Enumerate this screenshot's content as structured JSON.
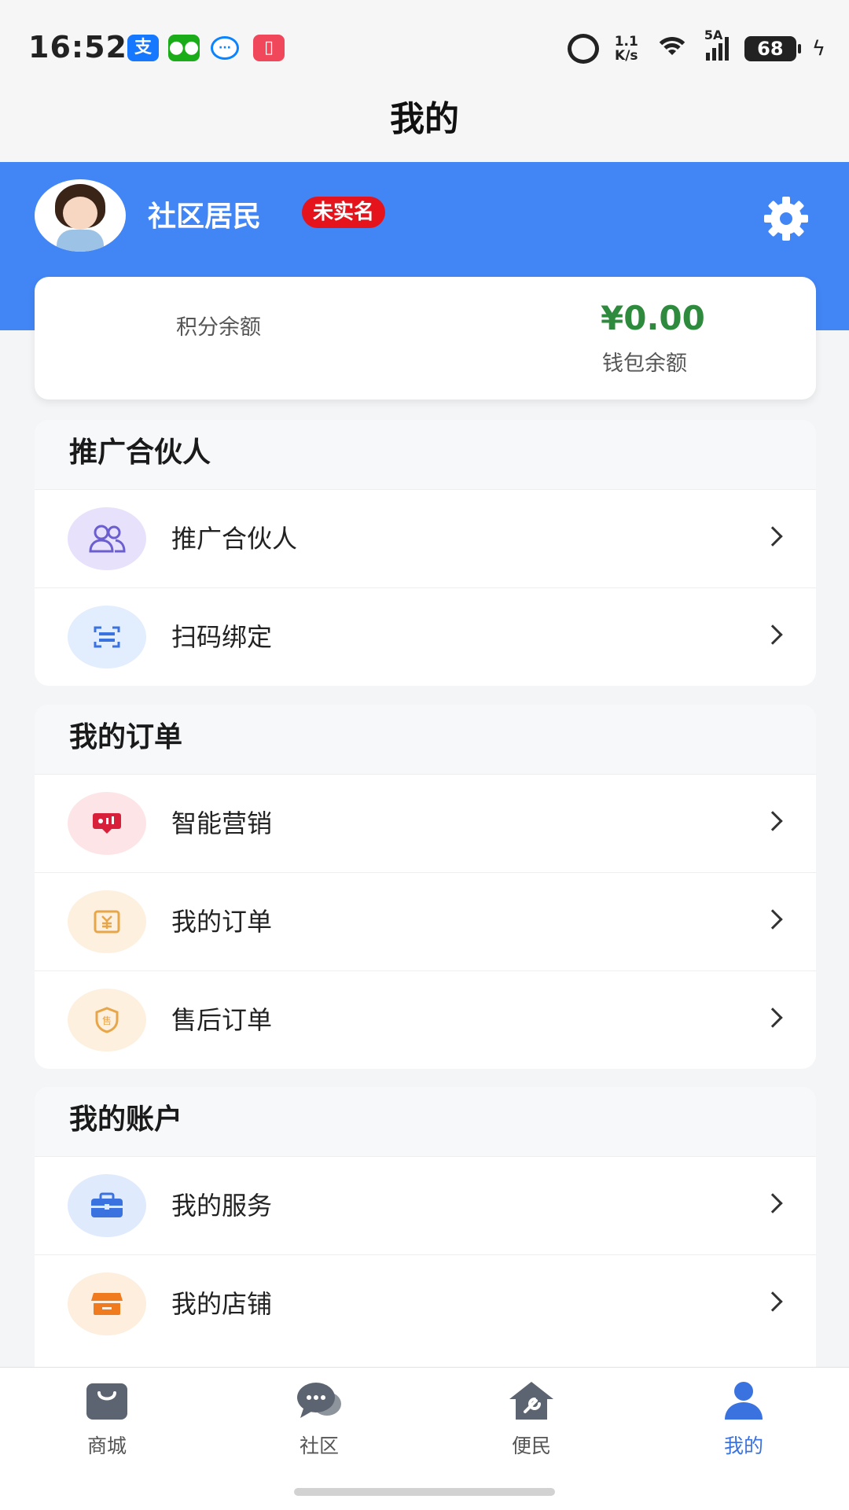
{
  "status_bar": {
    "time": "16:52",
    "speed_top": "1.1",
    "speed_bottom": "K/s",
    "network": "5A",
    "battery": "68"
  },
  "page_title": "我的",
  "profile": {
    "username": "社区居民",
    "verify_badge": "未实名"
  },
  "balances": {
    "points_label": "积分余额",
    "wallet_amount": "¥0.00",
    "wallet_label": "钱包余额"
  },
  "sections": {
    "partner": {
      "title": "推广合伙人",
      "items": [
        {
          "label": "推广合伙人"
        },
        {
          "label": "扫码绑定"
        }
      ]
    },
    "orders": {
      "title": "我的订单",
      "items": [
        {
          "label": "智能营销"
        },
        {
          "label": "我的订单"
        },
        {
          "label": "售后订单"
        }
      ]
    },
    "account": {
      "title": "我的账户",
      "items": [
        {
          "label": "我的服务"
        },
        {
          "label": "我的店铺"
        }
      ]
    }
  },
  "tabbar": {
    "tabs": [
      {
        "label": "商城"
      },
      {
        "label": "社区"
      },
      {
        "label": "便民"
      },
      {
        "label": "我的"
      }
    ]
  },
  "colors": {
    "brand_blue": "#4285f4",
    "wallet_green": "#2e8b3d",
    "badge_red": "#e5141c",
    "active_tab": "#3a73e0"
  },
  "icons": {
    "status_apps": [
      "alipay-icon",
      "wechat-icon",
      "message-bubble-icon",
      "book-reader-icon"
    ],
    "menu": [
      "partner-group-icon",
      "scan-qr-icon",
      "marketing-board-icon",
      "order-yuan-icon",
      "after-sale-shield-icon",
      "briefcase-icon",
      "store-icon"
    ],
    "tabs": [
      "shopping-bag-icon",
      "chat-bubbles-icon",
      "house-tools-icon",
      "person-icon"
    ]
  }
}
